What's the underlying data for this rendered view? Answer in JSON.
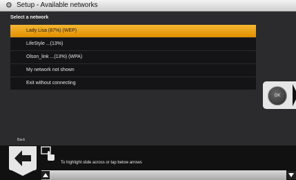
{
  "window": {
    "title": "Setup - Available networks",
    "icon": "gear-icon"
  },
  "heading": "Select a network",
  "networks": [
    {
      "label": "Lady Lisa (87%) (WEP)",
      "selected": true
    },
    {
      "label": "LifeStyle ...(13%)",
      "selected": false
    },
    {
      "label": "Olson_link ...(13%) (WPA)",
      "selected": false
    },
    {
      "label": "My network not shown",
      "selected": false
    },
    {
      "label": "Exit without connecting",
      "selected": false
    }
  ],
  "ok_label": "OK",
  "back_label": "Back",
  "hint_text": "To highlight slide across or tap below arrows",
  "colors": {
    "accent": "#f0a51c",
    "background": "#2b2b2d",
    "list_item": "#141416"
  }
}
